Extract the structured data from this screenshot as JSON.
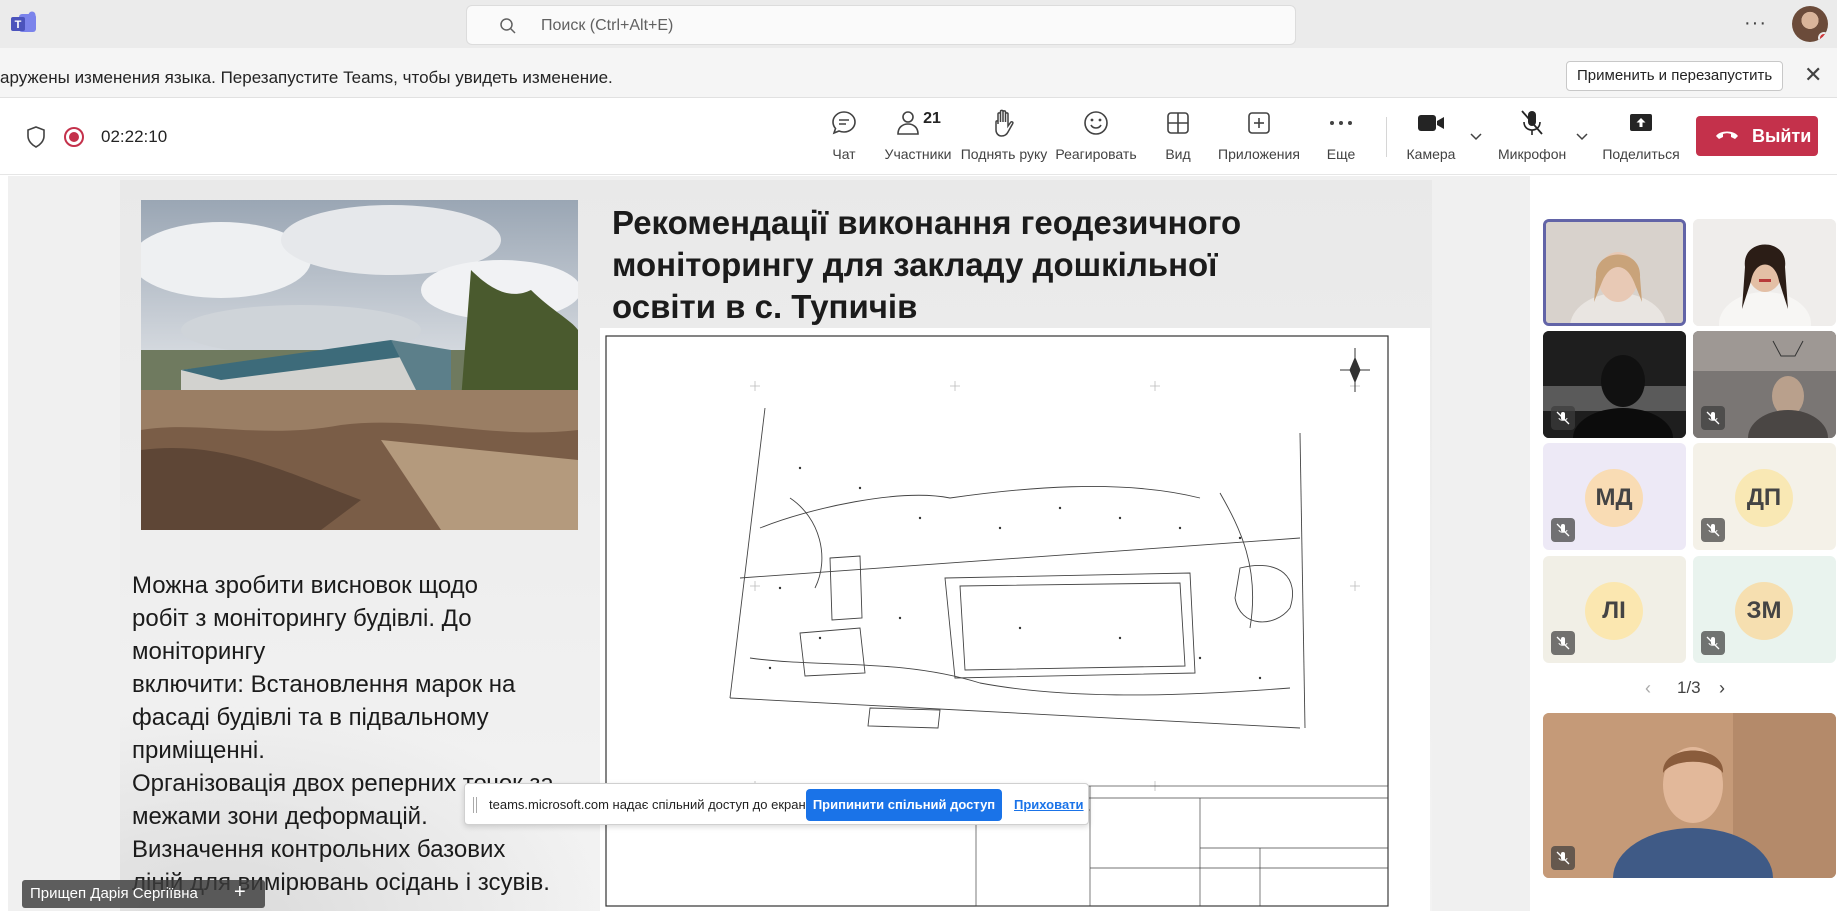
{
  "search": {
    "placeholder": "Поиск (Ctrl+Alt+E)"
  },
  "notice": {
    "message": "аружены изменения языка. Перезапустите Teams, чтобы увидеть изменение.",
    "button": "Применить и перезапустить"
  },
  "meeting": {
    "timer": "02:22:10",
    "participants_count": "21",
    "tools": {
      "chat": "Чат",
      "people": "Участники",
      "raise": "Поднять руку",
      "react": "Реагировать",
      "view": "Вид",
      "apps": "Приложения",
      "more": "Еще",
      "camera": "Камера",
      "mic": "Микрофон",
      "share": "Поделиться"
    },
    "leave": "Выйти"
  },
  "slide": {
    "title_lines": [
      "Рекомендації виконання геодезичного",
      "моніторингу для закладу дошкільної",
      "освіти в с. Тупичів"
    ],
    "body_lines": [
      "Можна зробити висновок щодо",
      "робіт з моніторингу будівлі. До",
      "моніторингу",
      "включити: Встановлення марок на",
      "фасаді будівлі та в підвальному",
      "приміщенні.",
      "Організовація двох реперних точок за",
      "межами зони деформацій.",
      "Визначення контрольних базових",
      "ліній для вимірювань осідань і зсувів."
    ]
  },
  "share_bar": {
    "text": "teams.microsoft.com надає спільний доступ до екрана.",
    "stop": "Припинити спільний доступ",
    "hide": "Приховати"
  },
  "presenter": {
    "name": "Прищеп Дарія Сергіївна"
  },
  "tiles": [
    {
      "initials": "МД"
    },
    {
      "initials": "ДП"
    },
    {
      "initials": "ЛІ"
    },
    {
      "initials": "ЗМ"
    }
  ],
  "pager": {
    "label": "1/3"
  },
  "colors": {
    "accent": "#6264a7",
    "leave": "#c4314b",
    "share_button": "#1a73e8"
  }
}
